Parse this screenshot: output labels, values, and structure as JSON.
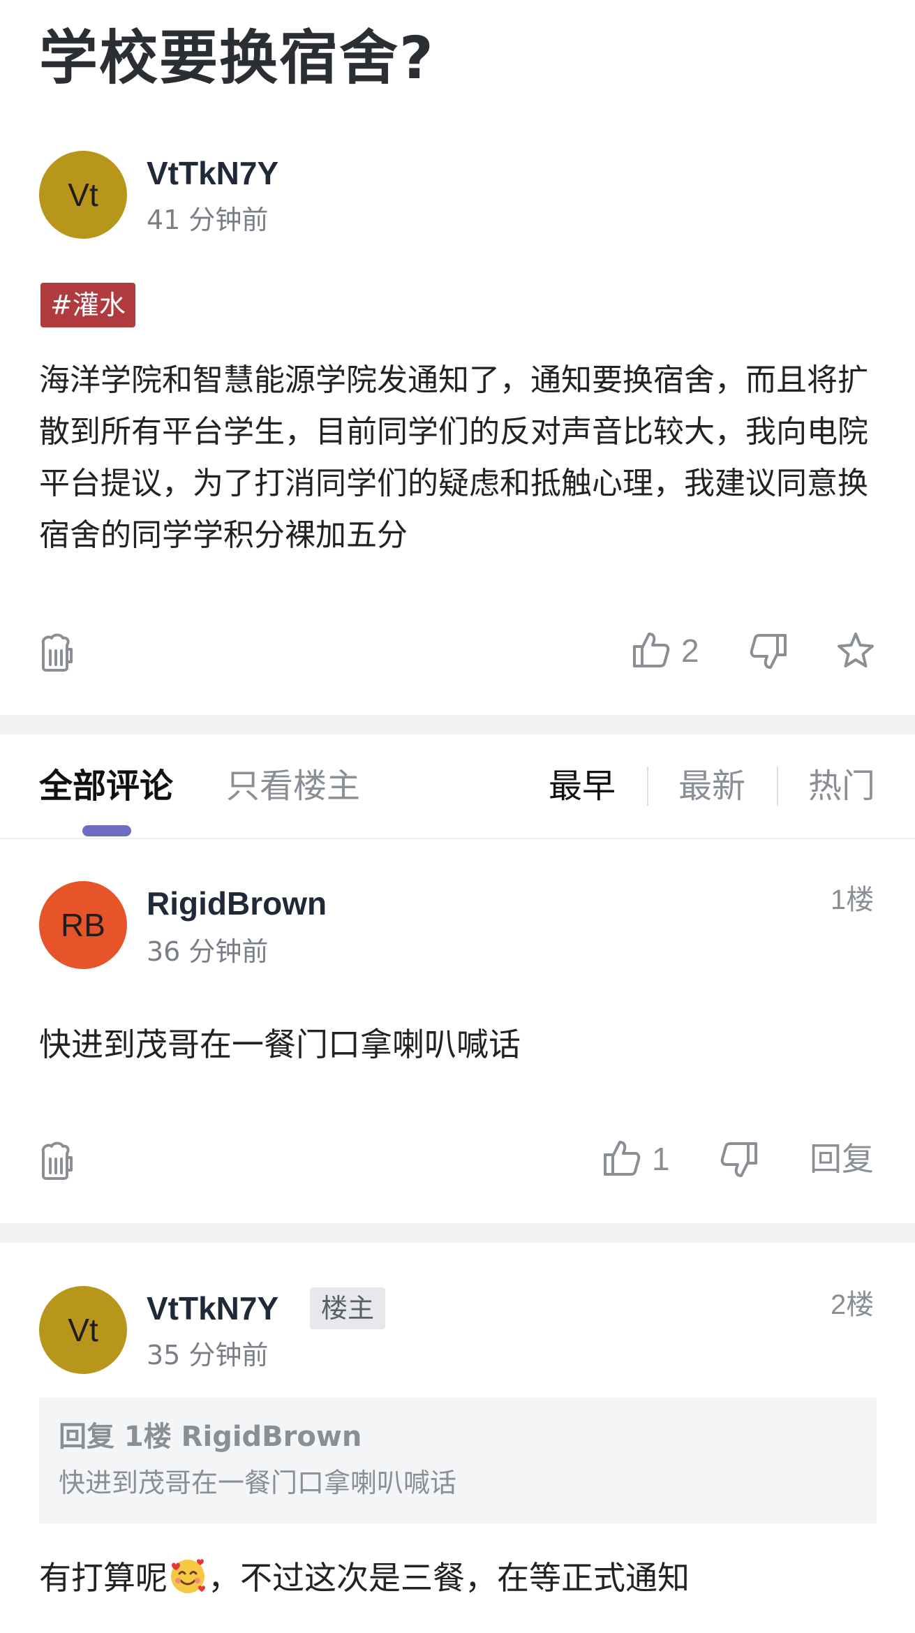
{
  "post": {
    "title": "学校要换宿舍?",
    "author": {
      "avatar_text": "Vt",
      "name": "VtTkN7Y",
      "time": "41 分钟前"
    },
    "tag": "#灌水",
    "body": "海洋学院和智慧能源学院发通知了，通知要换宿舍，而且将扩散到所有平台学生，目前同学们的反对声音比较大，我向电院平台提议，为了打消同学们的疑虑和抵触心理，我建议同意换宿舍的同学学积分裸加五分",
    "likes": "2",
    "icons": {
      "reward": "beer-mug-icon",
      "like": "thumbs-up-icon",
      "dislike": "thumbs-down-icon",
      "favorite": "star-icon"
    }
  },
  "tabs": {
    "all_comments": "全部评论",
    "op_only": "只看楼主",
    "sort": [
      "最早",
      "最新",
      "热门"
    ],
    "active_sort": "最早"
  },
  "comments": [
    {
      "floor": "1楼",
      "author": {
        "avatar_text": "RB",
        "name": "RigidBrown",
        "time": "36 分钟前"
      },
      "body": "快进到茂哥在一餐门口拿喇叭喊话",
      "likes": "1",
      "reply_label": "回复"
    },
    {
      "floor": "2楼",
      "author": {
        "avatar_text": "Vt",
        "name": "VtTkN7Y",
        "time": "35 分钟前",
        "badge": "楼主"
      },
      "quote": {
        "header": "回复 1楼 RigidBrown",
        "text": "快进到茂哥在一餐门口拿喇叭喊话"
      },
      "body_before_emoji": "有打算呢",
      "emoji": "smiling-face-with-hearts-emoji",
      "body_after_emoji": "，不过这次是三餐，在等正式通知"
    }
  ],
  "colors": {
    "gold_avatar": "#b8961c",
    "orange_avatar": "#e8542a",
    "tag_bg": "#b03a3e",
    "tab_indicator": "#6d6dc0",
    "muted": "#8a8f96"
  }
}
